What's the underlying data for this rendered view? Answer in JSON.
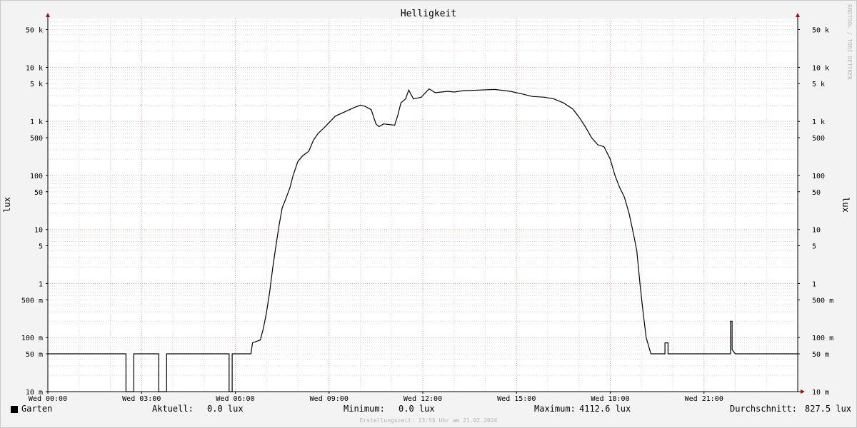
{
  "chart_data": {
    "type": "line",
    "title": "Helligkeit",
    "ylabel": "lux",
    "y_scale": "log",
    "ylim": [
      0.01,
      80000
    ],
    "y_ticks": [
      {
        "value": 50000,
        "label": "50 k"
      },
      {
        "value": 10000,
        "label": "10 k"
      },
      {
        "value": 5000,
        "label": "5 k"
      },
      {
        "value": 1000,
        "label": "1 k"
      },
      {
        "value": 500,
        "label": "500"
      },
      {
        "value": 100,
        "label": "100"
      },
      {
        "value": 50,
        "label": "50"
      },
      {
        "value": 10,
        "label": "10"
      },
      {
        "value": 5,
        "label": "5"
      },
      {
        "value": 1,
        "label": "1"
      },
      {
        "value": 0.5,
        "label": "500 m"
      },
      {
        "value": 0.1,
        "label": "100 m"
      },
      {
        "value": 0.05,
        "label": "50 m"
      },
      {
        "value": 0.01,
        "label": "10 m"
      }
    ],
    "xlim": [
      0,
      24
    ],
    "x_unit": "hours",
    "x_ticks": [
      {
        "value": 0,
        "label": "Wed 00:00"
      },
      {
        "value": 3,
        "label": "Wed 03:00"
      },
      {
        "value": 6,
        "label": "Wed 06:00"
      },
      {
        "value": 9,
        "label": "Wed 09:00"
      },
      {
        "value": 12,
        "label": "Wed 12:00"
      },
      {
        "value": 15,
        "label": "Wed 15:00"
      },
      {
        "value": 18,
        "label": "Wed 18:00"
      },
      {
        "value": 21,
        "label": "Wed 21:00"
      }
    ],
    "grid": true,
    "series": [
      {
        "name": "Garten",
        "color": "#000000",
        "points": [
          [
            0,
            0.05
          ],
          [
            2.5,
            0.05
          ],
          [
            2.5,
            0.01
          ],
          [
            2.75,
            0.01
          ],
          [
            2.75,
            0.05
          ],
          [
            3.55,
            0.05
          ],
          [
            3.55,
            0.01
          ],
          [
            3.8,
            0.01
          ],
          [
            3.8,
            0.05
          ],
          [
            5.8,
            0.05
          ],
          [
            5.8,
            0.01
          ],
          [
            5.9,
            0.01
          ],
          [
            5.9,
            0.05
          ],
          [
            6.5,
            0.05
          ],
          [
            6.55,
            0.08
          ],
          [
            6.8,
            0.09
          ],
          [
            6.9,
            0.15
          ],
          [
            7.0,
            0.3
          ],
          [
            7.1,
            0.7
          ],
          [
            7.2,
            2
          ],
          [
            7.3,
            5
          ],
          [
            7.4,
            12
          ],
          [
            7.5,
            25
          ],
          [
            7.6,
            35
          ],
          [
            7.75,
            60
          ],
          [
            7.85,
            100
          ],
          [
            8.0,
            180
          ],
          [
            8.15,
            230
          ],
          [
            8.35,
            280
          ],
          [
            8.5,
            450
          ],
          [
            8.65,
            600
          ],
          [
            8.8,
            720
          ],
          [
            9.0,
            950
          ],
          [
            9.2,
            1250
          ],
          [
            9.5,
            1500
          ],
          [
            9.8,
            1800
          ],
          [
            10.0,
            2000
          ],
          [
            10.15,
            1900
          ],
          [
            10.35,
            1650
          ],
          [
            10.5,
            900
          ],
          [
            10.6,
            800
          ],
          [
            10.75,
            900
          ],
          [
            11.1,
            850
          ],
          [
            11.2,
            1300
          ],
          [
            11.3,
            2200
          ],
          [
            11.45,
            2600
          ],
          [
            11.55,
            3800
          ],
          [
            11.7,
            2600
          ],
          [
            11.95,
            2800
          ],
          [
            12.2,
            4000
          ],
          [
            12.4,
            3400
          ],
          [
            12.6,
            3500
          ],
          [
            12.8,
            3600
          ],
          [
            13.0,
            3500
          ],
          [
            13.3,
            3700
          ],
          [
            13.8,
            3800
          ],
          [
            14.3,
            3900
          ],
          [
            14.8,
            3600
          ],
          [
            15.2,
            3200
          ],
          [
            15.5,
            2900
          ],
          [
            15.9,
            2800
          ],
          [
            16.2,
            2600
          ],
          [
            16.5,
            2200
          ],
          [
            16.8,
            1700
          ],
          [
            17.0,
            1200
          ],
          [
            17.2,
            800
          ],
          [
            17.4,
            500
          ],
          [
            17.6,
            370
          ],
          [
            17.8,
            340
          ],
          [
            18.0,
            200
          ],
          [
            18.15,
            100
          ],
          [
            18.3,
            60
          ],
          [
            18.45,
            40
          ],
          [
            18.6,
            20
          ],
          [
            18.75,
            8
          ],
          [
            18.85,
            4
          ],
          [
            18.95,
            1
          ],
          [
            19.05,
            0.3
          ],
          [
            19.15,
            0.1
          ],
          [
            19.3,
            0.05
          ],
          [
            19.75,
            0.05
          ],
          [
            19.75,
            0.08
          ],
          [
            19.85,
            0.08
          ],
          [
            19.85,
            0.05
          ],
          [
            21.85,
            0.05
          ],
          [
            21.85,
            0.2
          ],
          [
            21.9,
            0.2
          ],
          [
            21.9,
            0.06
          ],
          [
            22.0,
            0.05
          ],
          [
            24.0,
            0.05
          ]
        ]
      }
    ]
  },
  "legend": {
    "series_name": "Garten",
    "current_label": "Aktuell:",
    "current_value": "0.0 lux",
    "min_label": "Minimum:",
    "min_value": "0.0 lux",
    "max_label": "Maximum:",
    "max_value": "4112.6 lux",
    "avg_label": "Durchschnitt:",
    "avg_value": "827.5 lux"
  },
  "footer": "Erstellungszeit: 23:55 Uhr am 21.02.2024",
  "watermark": "RRDTOOL / TOBI OETIKER",
  "colors": {
    "background": "#f3f3f3",
    "plot_background": "#ffffff",
    "major_grid": "#e8a0a0",
    "minor_grid": "#d8d8d8",
    "line": "#000000",
    "axis_arrow": "#a01010"
  }
}
